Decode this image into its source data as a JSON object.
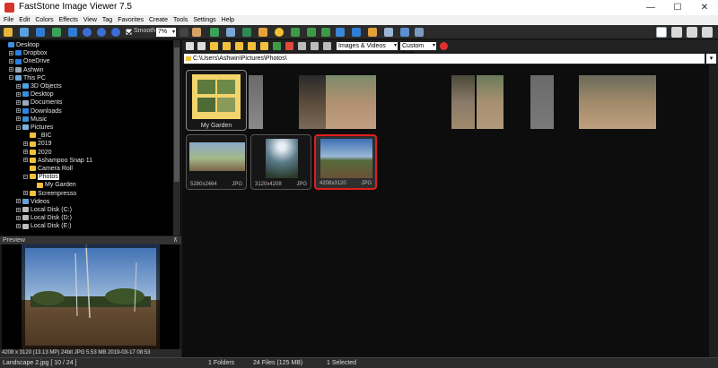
{
  "window": {
    "title": "FastStone Image Viewer 7.5",
    "minimize": "—",
    "maximize": "☐",
    "close": "✕"
  },
  "menu": [
    "File",
    "Edit",
    "Colors",
    "Effects",
    "View",
    "Tag",
    "Favorites",
    "Create",
    "Tools",
    "Settings",
    "Help"
  ],
  "toolbar": {
    "smooth_label": "Smooth",
    "smooth_checked": true,
    "zoom_value": "7%"
  },
  "tree": [
    {
      "label": "Desktop",
      "level": 0,
      "expander": "",
      "icon": "#3c8dde"
    },
    {
      "label": "Dropbox",
      "level": 1,
      "expander": "+",
      "icon": "#2b7fe0"
    },
    {
      "label": "OneDrive",
      "level": 1,
      "expander": "+",
      "icon": "#2b7fe0"
    },
    {
      "label": "Ashwin",
      "level": 1,
      "expander": "+",
      "icon": "#9aa7b6"
    },
    {
      "label": "This PC",
      "level": 1,
      "expander": "−",
      "icon": "#6fa8dc"
    },
    {
      "label": "3D Objects",
      "level": 2,
      "expander": "+",
      "icon": "#4aa3df"
    },
    {
      "label": "Desktop",
      "level": 2,
      "expander": "+",
      "icon": "#3c8dde"
    },
    {
      "label": "Documents",
      "level": 2,
      "expander": "+",
      "icon": "#9ab"
    },
    {
      "label": "Downloads",
      "level": 2,
      "expander": "+",
      "icon": "#2e86de"
    },
    {
      "label": "Music",
      "level": 2,
      "expander": "+",
      "icon": "#3a8fd6"
    },
    {
      "label": "Pictures",
      "level": 2,
      "expander": "−",
      "icon": "#7fb3e0"
    },
    {
      "label": "_BIC",
      "level": 3,
      "expander": "",
      "icon": "#f3c13a"
    },
    {
      "label": "2019",
      "level": 3,
      "expander": "+",
      "icon": "#f3c13a"
    },
    {
      "label": "2020",
      "level": 3,
      "expander": "+",
      "icon": "#f3c13a"
    },
    {
      "label": "Ashampoo Snap 11",
      "level": 3,
      "expander": "+",
      "icon": "#f3c13a"
    },
    {
      "label": "Camera Roll",
      "level": 3,
      "expander": "",
      "icon": "#f3c13a"
    },
    {
      "label": "Photos",
      "level": 3,
      "expander": "−",
      "icon": "#f3c13a",
      "selected": true
    },
    {
      "label": "My Garden",
      "level": 4,
      "expander": "",
      "icon": "#f3c13a"
    },
    {
      "label": "Screenpresso",
      "level": 3,
      "expander": "+",
      "icon": "#f3c13a"
    },
    {
      "label": "Videos",
      "level": 2,
      "expander": "+",
      "icon": "#6aa0d8"
    },
    {
      "label": "Local Disk (C:)",
      "level": 2,
      "expander": "+",
      "icon": "#bbb"
    },
    {
      "label": "Local Disk (D:)",
      "level": 2,
      "expander": "+",
      "icon": "#bbb"
    },
    {
      "label": "Local Disk (E:)",
      "level": 2,
      "expander": "+",
      "icon": "#bbb"
    }
  ],
  "preview": {
    "header": "Preview",
    "info": "4208 x 3120 (13.13 MP)  24bit  JPG  5.53 MB   2019-03-17 08:53"
  },
  "nav": {
    "filter": "Images & Videos",
    "sort": "Custom Sort"
  },
  "address": "C:\\Users\\Ashwin\\Pictures\\Photos\\",
  "thumbnails": [
    {
      "label": "My Garden",
      "type": "folder"
    },
    {
      "dims": "5280x2464",
      "format": "JPG"
    },
    {
      "dims": "3120x4208",
      "format": "JPG"
    },
    {
      "dims": "4208x3120",
      "format": "JPG",
      "selected": true
    }
  ],
  "status": {
    "file": "Landscape 2.jpg [ 10 / 24 ]",
    "folders": "1 Folders",
    "files": "24 Files (125 MB)",
    "selected": "1 Selected"
  }
}
